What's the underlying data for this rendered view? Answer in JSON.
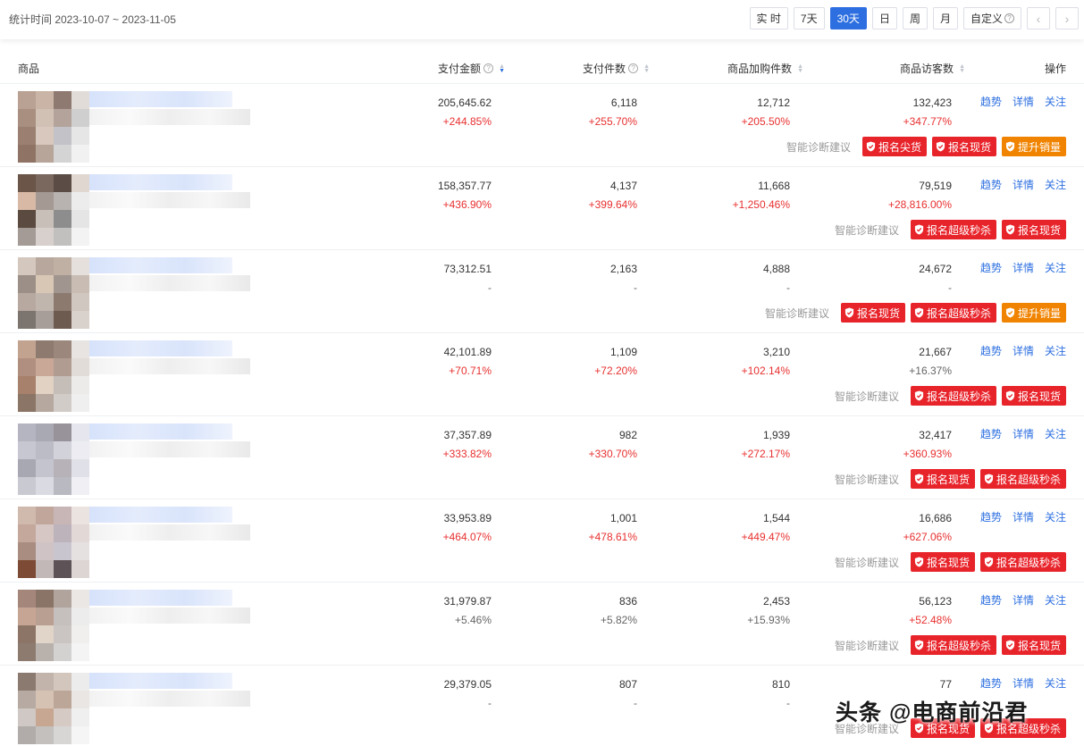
{
  "header": {
    "stat_time": "统计时间 2023-10-07 ~ 2023-11-05",
    "ranges": [
      {
        "label": "实 时",
        "active": false
      },
      {
        "label": "7天",
        "active": false
      },
      {
        "label": "30天",
        "active": true
      },
      {
        "label": "日",
        "active": false
      },
      {
        "label": "周",
        "active": false
      },
      {
        "label": "月",
        "active": false
      }
    ],
    "custom_label": "自定义",
    "prev_icon": "chevron-left-icon",
    "next_icon": "chevron-right-icon"
  },
  "columns": {
    "product": "商品",
    "pay_amount": "支付金额",
    "pay_count": "支付件数",
    "cart_count": "商品加购件数",
    "visitors": "商品访客数",
    "actions": "操作"
  },
  "action_labels": {
    "trend": "趋势",
    "detail": "详情",
    "follow": "关注"
  },
  "diag_label": "智能诊断建议",
  "colors": {
    "accent": "#2d6fe0",
    "increase": "#e83030",
    "tag_red": "#e8242b",
    "tag_orange": "#f08300"
  },
  "rows": [
    {
      "amount": "205,645.62",
      "amount_chg": "+244.85%",
      "count": "6,118",
      "count_chg": "+255.70%",
      "cart": "12,712",
      "cart_chg": "+205.50%",
      "visitors": "132,423",
      "visitors_chg": "+347.77%",
      "tags": [
        {
          "label": "报名尖货",
          "color": "red"
        },
        {
          "label": "报名现货",
          "color": "red"
        },
        {
          "label": "提升销量",
          "color": "orange"
        }
      ]
    },
    {
      "amount": "158,357.77",
      "amount_chg": "+436.90%",
      "count": "4,137",
      "count_chg": "+399.64%",
      "cart": "11,668",
      "cart_chg": "+1,250.46%",
      "visitors": "79,519",
      "visitors_chg": "+28,816.00%",
      "tags": [
        {
          "label": "报名超级秒杀",
          "color": "red"
        },
        {
          "label": "报名现货",
          "color": "red"
        }
      ]
    },
    {
      "amount": "73,312.51",
      "amount_chg": "-",
      "count": "2,163",
      "count_chg": "-",
      "cart": "4,888",
      "cart_chg": "-",
      "visitors": "24,672",
      "visitors_chg": "-",
      "tags": [
        {
          "label": "报名现货",
          "color": "red"
        },
        {
          "label": "报名超级秒杀",
          "color": "red"
        },
        {
          "label": "提升销量",
          "color": "orange"
        }
      ]
    },
    {
      "amount": "42,101.89",
      "amount_chg": "+70.71%",
      "count": "1,109",
      "count_chg": "+72.20%",
      "cart": "3,210",
      "cart_chg": "+102.14%",
      "visitors": "21,667",
      "visitors_chg": "+16.37%",
      "tags": [
        {
          "label": "报名超级秒杀",
          "color": "red"
        },
        {
          "label": "报名现货",
          "color": "red"
        }
      ]
    },
    {
      "amount": "37,357.89",
      "amount_chg": "+333.82%",
      "count": "982",
      "count_chg": "+330.70%",
      "cart": "1,939",
      "cart_chg": "+272.17%",
      "visitors": "32,417",
      "visitors_chg": "+360.93%",
      "tags": [
        {
          "label": "报名现货",
          "color": "red"
        },
        {
          "label": "报名超级秒杀",
          "color": "red"
        }
      ]
    },
    {
      "amount": "33,953.89",
      "amount_chg": "+464.07%",
      "count": "1,001",
      "count_chg": "+478.61%",
      "cart": "1,544",
      "cart_chg": "+449.47%",
      "visitors": "16,686",
      "visitors_chg": "+627.06%",
      "tags": [
        {
          "label": "报名现货",
          "color": "red"
        },
        {
          "label": "报名超级秒杀",
          "color": "red"
        }
      ]
    },
    {
      "amount": "31,979.87",
      "amount_chg": "+5.46%",
      "count": "836",
      "count_chg": "+5.82%",
      "cart": "2,453",
      "cart_chg": "+15.93%",
      "visitors": "56,123",
      "visitors_chg": "+52.48%",
      "tags": [
        {
          "label": "报名超级秒杀",
          "color": "red"
        },
        {
          "label": "报名现货",
          "color": "red"
        }
      ]
    },
    {
      "amount": "29,379.05",
      "amount_chg": "-",
      "count": "807",
      "count_chg": "-",
      "cart": "810",
      "cart_chg": "-",
      "visitors": "77",
      "visitors_chg": "-",
      "tags": [
        {
          "label": "报名现货",
          "color": "red"
        },
        {
          "label": "报名超级秒杀",
          "color": "red"
        }
      ]
    }
  ],
  "watermark": "头条 @电商前沿君"
}
